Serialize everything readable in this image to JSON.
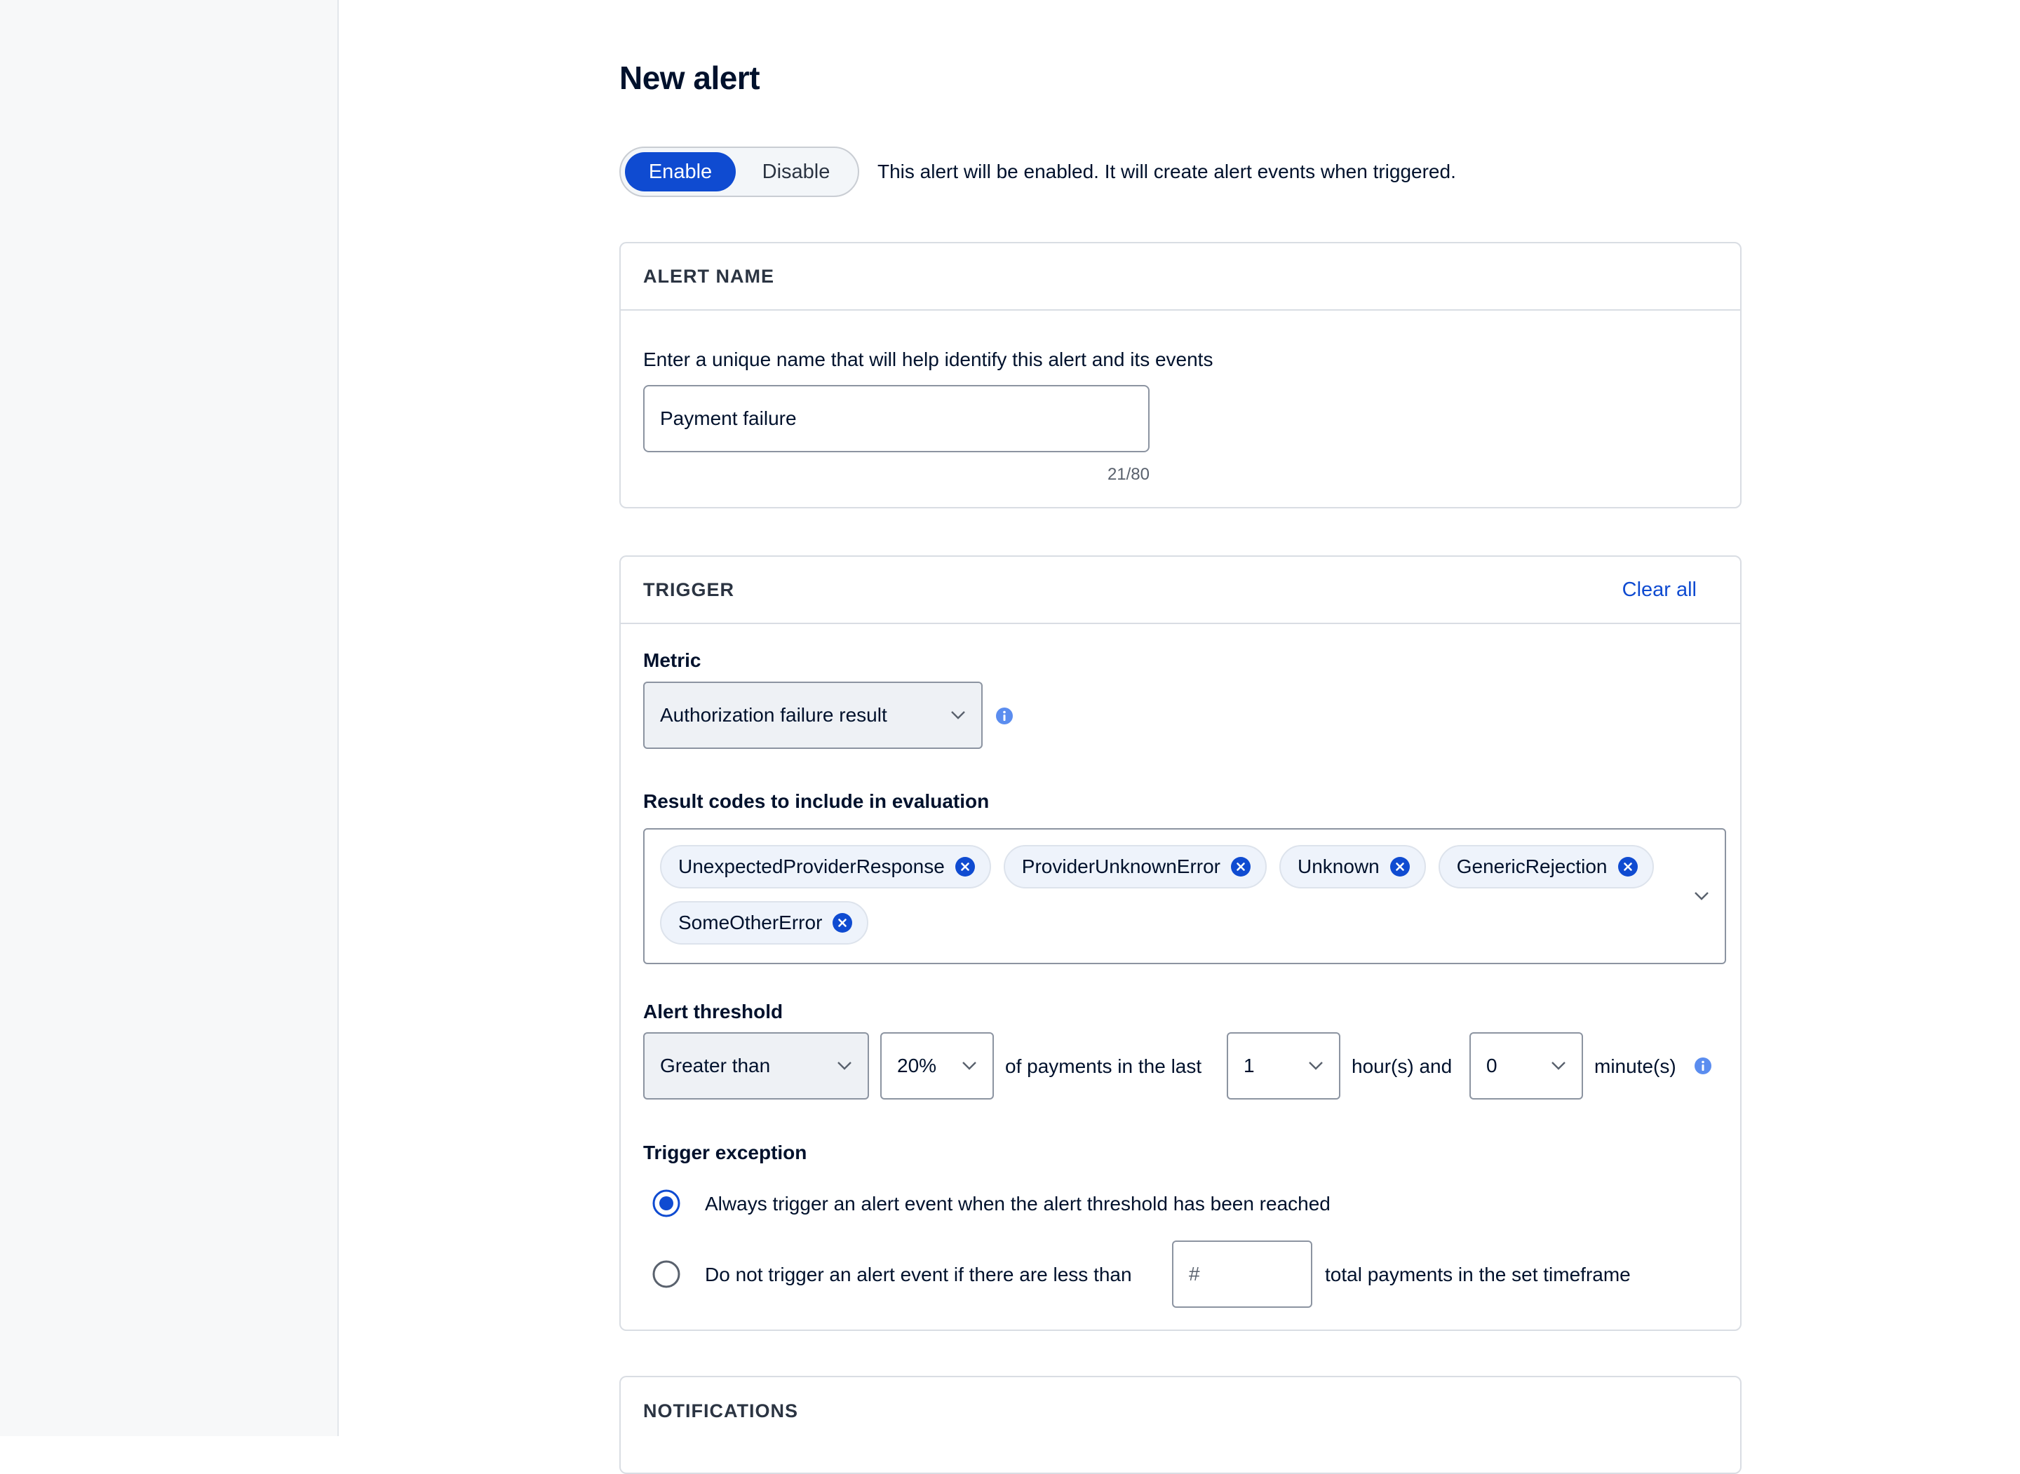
{
  "page": {
    "title": "New alert"
  },
  "status_toggle": {
    "enable_label": "Enable",
    "disable_label": "Disable",
    "selected": "Enable",
    "description": "This alert will be enabled. It will create alert events when triggered."
  },
  "alert_name": {
    "section_title": "ALERT NAME",
    "description": "Enter a unique name that will help identify this alert and its events",
    "value": "Payment failure",
    "counter": "21/80"
  },
  "trigger": {
    "section_title": "TRIGGER",
    "clear_all_label": "Clear all",
    "metric": {
      "label": "Metric",
      "value": "Authorization failure result"
    },
    "result_codes": {
      "label": "Result codes to include in evaluation",
      "selected": [
        "UnexpectedProviderResponse",
        "ProviderUnknownError",
        "Unknown",
        "GenericRejection",
        "SomeOtherError"
      ]
    },
    "threshold": {
      "label": "Alert threshold",
      "comparison": "Greater than",
      "percentage": "20%",
      "text_payments": "of payments in the last",
      "hours": "1",
      "text_hours": "hour(s) and",
      "minutes": "0",
      "text_minutes": "minute(s)"
    },
    "exception": {
      "label": "Trigger exception",
      "option_always": "Always trigger an alert event when the alert threshold has been reached",
      "option_min_prefix": "Do not trigger an alert event if there are less than",
      "min_placeholder": "#",
      "option_min_suffix": "total payments in the set timeframe",
      "selected": "always"
    }
  },
  "notifications": {
    "section_title": "NOTIFICATIONS"
  },
  "colors": {
    "primary": "#0f4bd1",
    "info": "#5b8def",
    "border": "#d9dde3",
    "sidebar_bg": "#f7f8f9"
  },
  "icons": [
    "chevron-down-icon",
    "info-icon",
    "close-icon",
    "radio-selected-icon",
    "radio-unselected-icon"
  ]
}
